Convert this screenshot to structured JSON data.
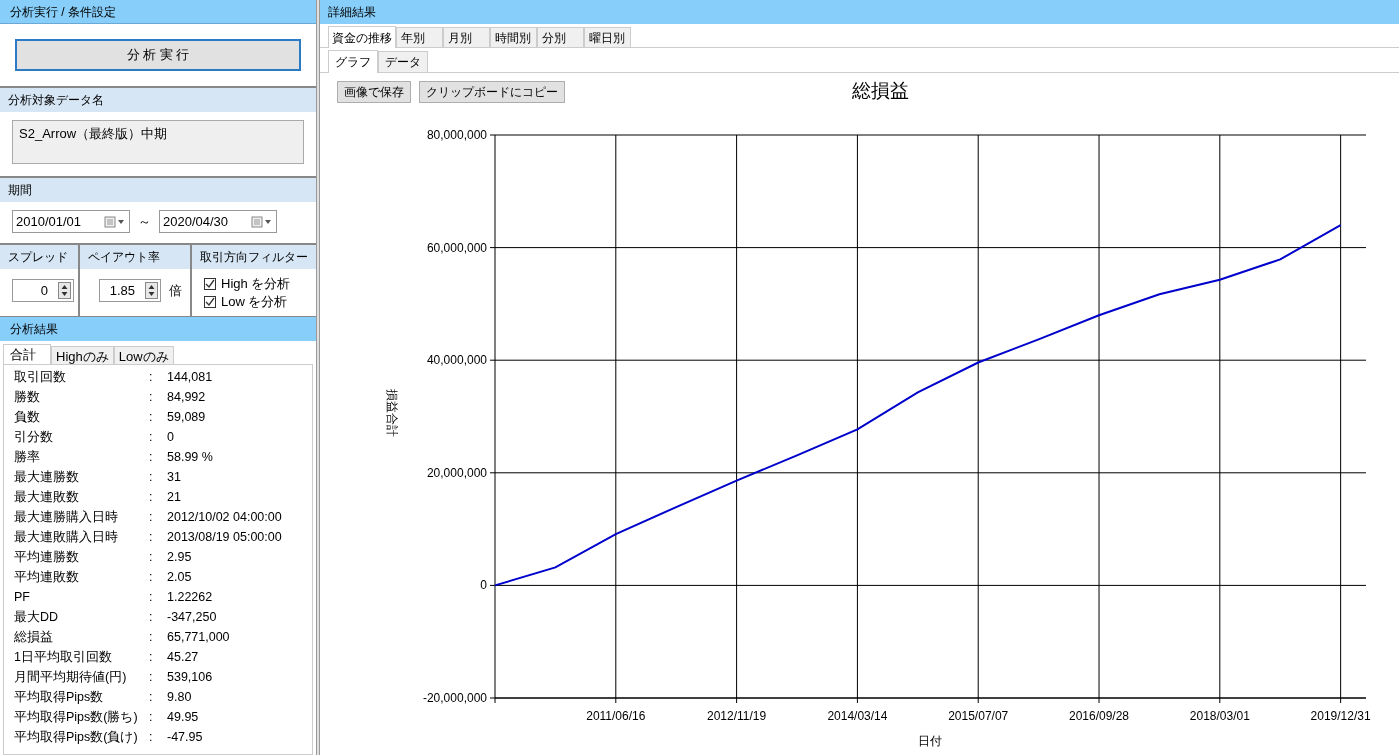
{
  "left_panel": {
    "title": "分析実行 / 条件設定",
    "run_button": "分 析 実 行",
    "data_name": {
      "header": "分析対象データ名",
      "value": "S2_Arrow（最終版）中期"
    },
    "period": {
      "header": "期間",
      "from": "2010/01/01",
      "separator": "～",
      "to": "2020/04/30"
    },
    "spread": {
      "header": "スプレッド",
      "value": "0"
    },
    "payout": {
      "header": "ペイアウト率",
      "value": "1.85",
      "unit": "倍"
    },
    "direction_filter": {
      "header": "取引方向フィルター",
      "options": [
        {
          "label": "High を分析",
          "checked": true
        },
        {
          "label": "Low を分析",
          "checked": true
        }
      ]
    }
  },
  "results": {
    "title": "分析結果",
    "tabs": [
      {
        "label": "合計",
        "selected": true
      },
      {
        "label": "Highのみ",
        "selected": false
      },
      {
        "label": "Lowのみ",
        "selected": false
      }
    ],
    "rows": [
      {
        "label": "取引回数",
        "colon": ":",
        "value": "144,081"
      },
      {
        "label": "勝数",
        "colon": ":",
        "value": "84,992"
      },
      {
        "label": "負数",
        "colon": ":",
        "value": "59,089"
      },
      {
        "label": "引分数",
        "colon": ":",
        "value": "0"
      },
      {
        "label": "勝率",
        "colon": ":",
        "value": "58.99 %"
      },
      {
        "label": "最大連勝数",
        "colon": ":",
        "value": "31"
      },
      {
        "label": "最大連敗数",
        "colon": ":",
        "value": "21"
      },
      {
        "label": "最大連勝購入日時",
        "colon": ":",
        "value": "2012/10/02 04:00:00"
      },
      {
        "label": "最大連敗購入日時",
        "colon": ":",
        "value": "2013/08/19 05:00:00"
      },
      {
        "label": "平均連勝数",
        "colon": ":",
        "value": "2.95"
      },
      {
        "label": "平均連敗数",
        "colon": ":",
        "value": "2.05"
      },
      {
        "label": "PF",
        "colon": ":",
        "value": "1.22262"
      },
      {
        "label": "最大DD",
        "colon": ":",
        "value": "-347,250"
      },
      {
        "label": "総損益",
        "colon": ":",
        "value": "65,771,000"
      },
      {
        "label": "1日平均取引回数",
        "colon": ":",
        "value": "45.27"
      },
      {
        "label": "月間平均期待値(円)",
        "colon": ":",
        "value": "539,106"
      },
      {
        "label": "平均取得Pips数",
        "colon": ":",
        "value": "9.80"
      },
      {
        "label": "平均取得Pips数(勝ち)",
        "colon": ":",
        "value": "49.95"
      },
      {
        "label": "平均取得Pips数(負け)",
        "colon": ":",
        "value": "-47.95"
      }
    ]
  },
  "detail": {
    "title": "詳細結果",
    "tabs": [
      {
        "label": "資金の推移",
        "selected": true
      },
      {
        "label": "年別",
        "selected": false
      },
      {
        "label": "月別",
        "selected": false
      },
      {
        "label": "時間別",
        "selected": false
      },
      {
        "label": "分別",
        "selected": false
      },
      {
        "label": "曜日別",
        "selected": false
      }
    ],
    "subtabs": [
      {
        "label": "グラフ",
        "selected": true
      },
      {
        "label": "データ",
        "selected": false
      }
    ],
    "buttons": [
      "画像で保存",
      "クリップボードにコピー"
    ],
    "chart_data": {
      "type": "line",
      "title": "総損益",
      "xlabel": "日付",
      "ylabel": "損益合計",
      "categories": [
        null,
        null,
        "2011/06/16",
        null,
        "2012/11/19",
        null,
        "2014/03/14",
        null,
        "2015/07/07",
        null,
        "2016/09/28",
        null,
        "2018/03/01",
        null,
        "2019/12/31"
      ],
      "series": [
        {
          "color": "#0000cc",
          "values": [
            0,
            3200000,
            9100000,
            13900000,
            18600000,
            23100000,
            27700000,
            34300000,
            39600000,
            43700000,
            48000000,
            51700000,
            54300000,
            57900000,
            64000000
          ]
        }
      ],
      "ylim": [
        -20000000,
        80000000
      ],
      "grid": true,
      "yticks": [
        {
          "value": -20000000,
          "label": "-20,000,000"
        },
        {
          "value": 0,
          "label": "0"
        },
        {
          "value": 20000000,
          "label": "20,000,000"
        },
        {
          "value": 40000000,
          "label": "40,000,000"
        },
        {
          "value": 60000000,
          "label": "60,000,000"
        },
        {
          "value": 80000000,
          "label": "80,000,000"
        }
      ]
    }
  }
}
